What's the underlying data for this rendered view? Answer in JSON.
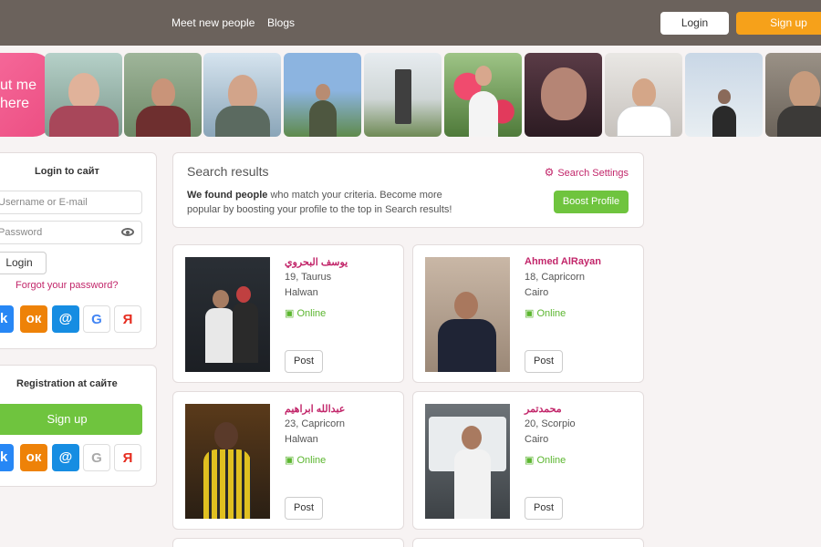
{
  "nav": {
    "meet_label": "Meet new people",
    "blogs_label": "Blogs",
    "login_label": "Login",
    "signup_label": "Sign up"
  },
  "strip": {
    "put_me_here": "ut me here"
  },
  "login_panel": {
    "title": "Login to сайт",
    "username_placeholder": "Username or E-mail",
    "password_placeholder": "Password",
    "login_button": "Login",
    "forgot_link": "Forgot your password?"
  },
  "registration_panel": {
    "title": "Registration at сайте",
    "signup_button": "Sign up"
  },
  "social": {
    "vk": "vk",
    "ok": "ок",
    "mail": "@",
    "google": "G",
    "yandex": "Я"
  },
  "search": {
    "title": "Search results",
    "settings_label": "Search Settings",
    "found_bold": "We found people",
    "found_rest": " who match your criteria. Become more popular by boosting your profile to the top in Search results!",
    "boost_label": "Boost Profile"
  },
  "profiles": [
    {
      "name": "يوسف البحروي",
      "age_sign": "19, Taurus",
      "city": "Halwan",
      "status": "Online",
      "post_label": "Post"
    },
    {
      "name": "Ahmed AlRayan",
      "age_sign": "18, Capricorn",
      "city": "Cairo",
      "status": "Online",
      "post_label": "Post"
    },
    {
      "name": "عبدالله ابراهيم",
      "age_sign": "23, Capricorn",
      "city": "Halwan",
      "status": "Online",
      "post_label": "Post"
    },
    {
      "name": "محمدتمر",
      "age_sign": "20, Scorpio",
      "city": "Cairo",
      "status": "Online",
      "post_label": "Post"
    }
  ],
  "colors": {
    "topbar": "#6b625c",
    "accent_pink": "#c2266a",
    "green": "#6fc43e",
    "orange": "#f6a11a"
  }
}
